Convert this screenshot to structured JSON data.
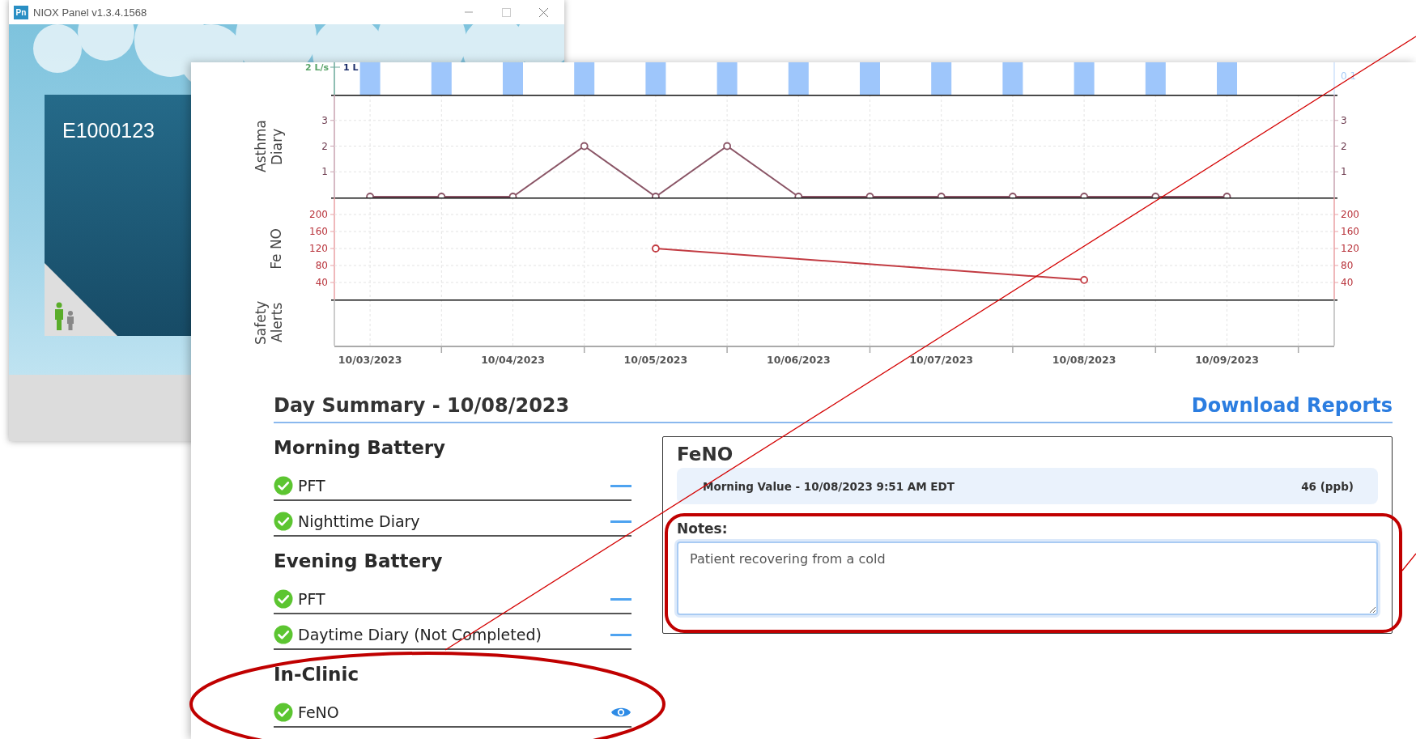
{
  "back_window": {
    "icon_label": "Pn",
    "title": "NIOX Panel v1.3.4.1568",
    "patient_id": "E1000123"
  },
  "chart": {
    "flow_panel": {
      "left_labels": [
        "2 L/s",
        "1 L"
      ],
      "right_label": "0.1"
    },
    "panels": [
      {
        "kind": "line",
        "right_ticks": [
          "3",
          "2",
          "1"
        ],
        "chart_data": {
          "type": "line",
          "categories": [
            null,
            null,
            null,
            null,
            null,
            null,
            null,
            null,
            null,
            null,
            null,
            null,
            null
          ],
          "series": [
            {
              "name": "Asthma Diary",
              "color": "#8a5566",
              "marker": "circle",
              "values": [
                0,
                0,
                0,
                2,
                0,
                2,
                0,
                0,
                0,
                0,
                0,
                0,
                0
              ]
            }
          ],
          "grid": true,
          "ylim": [
            0,
            4
          ],
          "yticks": [
            1,
            2,
            3
          ]
        }
      },
      {
        "kind": "line",
        "right_ticks": [
          "200",
          "160",
          "120",
          "80",
          "40"
        ],
        "chart_data": {
          "type": "line",
          "categories": [
            null,
            null,
            null,
            null,
            null,
            null,
            null,
            null,
            null,
            null,
            null,
            null,
            null
          ],
          "series": [
            {
              "name": "Fe NO",
              "color": "#c23b42",
              "marker": "circle",
              "values": [
                null,
                null,
                null,
                null,
                120,
                null,
                null,
                null,
                null,
                null,
                46,
                null,
                null
              ]
            }
          ],
          "grid": true,
          "ylim": [
            0,
            240
          ],
          "yticks": [
            40,
            80,
            120,
            160,
            200
          ]
        }
      },
      {
        "kind": "empty",
        "title": "Safety Alerts"
      }
    ],
    "date_labels": [
      "10/03/2023",
      "10/04/2023",
      "10/05/2023",
      "10/06/2023",
      "10/07/2023",
      "10/08/2023",
      "10/09/2023"
    ]
  },
  "summary": {
    "title": "Day Summary - 10/08/2023",
    "download_link": "Download Reports",
    "groups": [
      {
        "title": "Morning Battery",
        "items": [
          {
            "label": "PFT",
            "completed": true,
            "kind": "collapse"
          },
          {
            "label": "Nighttime Diary",
            "completed": true,
            "kind": "collapse"
          }
        ]
      },
      {
        "title": "Evening Battery",
        "items": [
          {
            "label": "PFT",
            "completed": true,
            "kind": "collapse"
          },
          {
            "label": "Daytime Diary (Not Completed)",
            "completed": true,
            "kind": "collapse"
          }
        ]
      },
      {
        "title": "In-Clinic",
        "items": [
          {
            "label": "FeNO",
            "completed": true,
            "kind": "view"
          }
        ]
      }
    ]
  },
  "detail": {
    "title": "FeNO",
    "reading_label": "Morning Value - 10/08/2023 9:51 AM EDT",
    "reading_value": "46 (ppb)",
    "notes_label": "Notes:",
    "notes_value": "Patient recovering from a cold",
    "notes_focused": true
  },
  "annotations": [
    {
      "kind": "ellipse"
    },
    {
      "kind": "rounded_rect"
    },
    {
      "kind": "line"
    },
    {
      "kind": "line"
    }
  ]
}
